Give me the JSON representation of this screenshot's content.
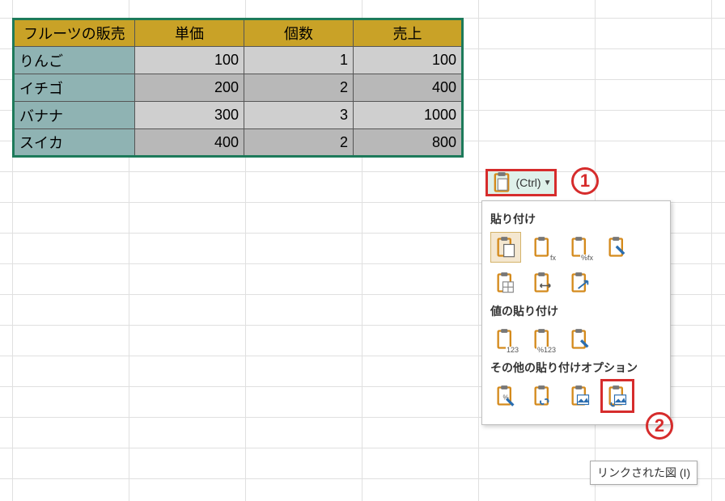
{
  "table": {
    "headers": [
      "フルーツの販売",
      "単価",
      "個数",
      "売上"
    ],
    "rows": [
      {
        "name": "りんご",
        "price": "100",
        "qty": "1",
        "sales": "100"
      },
      {
        "name": "イチゴ",
        "price": "200",
        "qty": "2",
        "sales": "400"
      },
      {
        "name": "バナナ",
        "price": "300",
        "qty": "3",
        "sales": "1000"
      },
      {
        "name": "スイカ",
        "price": "400",
        "qty": "2",
        "sales": "800"
      }
    ]
  },
  "paste_button": {
    "label": "(Ctrl)"
  },
  "annotations": {
    "one": "1",
    "two": "2"
  },
  "flyout": {
    "section_paste": "貼り付け",
    "section_values": "値の貼り付け",
    "section_other": "その他の貼り付けオプション",
    "icons": {
      "paste": "paste",
      "paste_fx": "fx",
      "paste_pctfx": "%fx",
      "paste_formatting": "brush",
      "paste_noborder": "grid",
      "paste_colwidth": "colw",
      "paste_transpose": "arrow",
      "val_123": "123",
      "val_pct123": "%123",
      "val_fmt": "12brush",
      "other_pctlink": "%link",
      "other_link": "link",
      "other_pic": "pic",
      "other_linked_pic": "linked-pic"
    }
  },
  "tooltip": "リンクされた図 (I)",
  "colors": {
    "selection_border": "#1d7a5a",
    "header_fill": "#c9a227",
    "name_fill": "#8fb3b3",
    "annotation": "#d62c2c"
  }
}
